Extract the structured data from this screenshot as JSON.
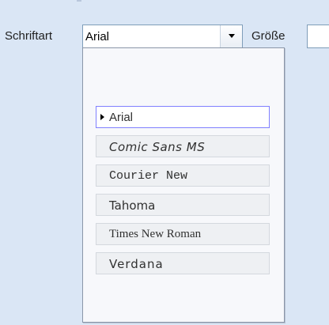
{
  "toolbar": {
    "font_label": "Schriftart",
    "font_value": "Arial",
    "size_label": "Größe",
    "size_value": ""
  },
  "dropdown": {
    "selected": "Arial",
    "items": [
      {
        "label": "Arial",
        "selected": true
      },
      {
        "label": "Comic Sans MS",
        "selected": false
      },
      {
        "label": "Courier New",
        "selected": false
      },
      {
        "label": "Tahoma",
        "selected": false
      },
      {
        "label": "Times New Roman",
        "selected": false
      },
      {
        "label": "Verdana",
        "selected": false
      }
    ]
  },
  "icons": {
    "combo_arrow": "chevron-down-icon",
    "selected_marker": "triangle-right-icon"
  },
  "colors": {
    "toolbar_bg": "#dae6f5",
    "field_border": "#7f9db9",
    "selected_border": "#8080ff"
  }
}
